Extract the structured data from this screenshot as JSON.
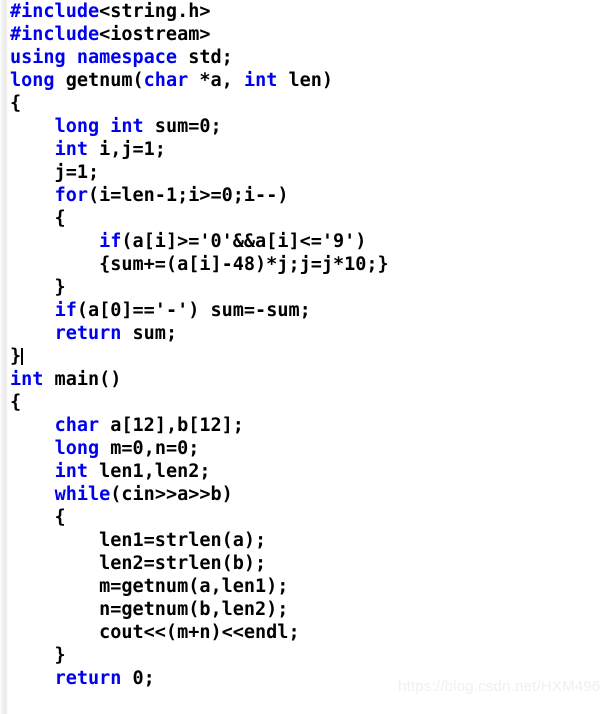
{
  "editor": {
    "background_color": "#ffffff",
    "text_color": "#000000",
    "keyword_color": "#0000f0",
    "font_size_px": 18.5,
    "line_height_px": 23,
    "language": "C++",
    "has_caret": true,
    "caret_line_index": 15
  },
  "code": {
    "lines": [
      {
        "index": 0,
        "tokens": [
          {
            "t": "#include",
            "c": "kw"
          },
          {
            "t": "<string.h>",
            "c": "pl"
          }
        ]
      },
      {
        "index": 1,
        "tokens": [
          {
            "t": "#include",
            "c": "kw"
          },
          {
            "t": "<iostream>",
            "c": "pl"
          }
        ]
      },
      {
        "index": 2,
        "tokens": [
          {
            "t": "using namespace",
            "c": "kw"
          },
          {
            "t": " std;",
            "c": "pl"
          }
        ]
      },
      {
        "index": 3,
        "tokens": [
          {
            "t": "long",
            "c": "kw"
          },
          {
            "t": " getnum(",
            "c": "pl"
          },
          {
            "t": "char",
            "c": "kw"
          },
          {
            "t": " *a, ",
            "c": "pl"
          },
          {
            "t": "int",
            "c": "kw"
          },
          {
            "t": " len)",
            "c": "pl"
          }
        ]
      },
      {
        "index": 4,
        "tokens": [
          {
            "t": "{",
            "c": "pl"
          }
        ]
      },
      {
        "index": 5,
        "tokens": [
          {
            "t": "    ",
            "c": "pl"
          },
          {
            "t": "long int",
            "c": "kw"
          },
          {
            "t": " sum=0;",
            "c": "pl"
          }
        ]
      },
      {
        "index": 6,
        "tokens": [
          {
            "t": "    ",
            "c": "pl"
          },
          {
            "t": "int",
            "c": "kw"
          },
          {
            "t": " i,j=1;",
            "c": "pl"
          }
        ]
      },
      {
        "index": 7,
        "tokens": [
          {
            "t": "    j=1;",
            "c": "pl"
          }
        ]
      },
      {
        "index": 8,
        "tokens": [
          {
            "t": "    ",
            "c": "pl"
          },
          {
            "t": "for",
            "c": "kw"
          },
          {
            "t": "(i=len-1;i>=0;i--)",
            "c": "pl"
          }
        ]
      },
      {
        "index": 9,
        "tokens": [
          {
            "t": "    {",
            "c": "pl"
          }
        ]
      },
      {
        "index": 10,
        "tokens": [
          {
            "t": "        ",
            "c": "pl"
          },
          {
            "t": "if",
            "c": "kw"
          },
          {
            "t": "(a[i]>='0'&&a[i]<='9')",
            "c": "pl"
          }
        ]
      },
      {
        "index": 11,
        "tokens": [
          {
            "t": "        {sum+=(a[i]-48)*j;j=j*10;}",
            "c": "pl"
          }
        ]
      },
      {
        "index": 12,
        "tokens": [
          {
            "t": "    }",
            "c": "pl"
          }
        ]
      },
      {
        "index": 13,
        "tokens": [
          {
            "t": "    ",
            "c": "pl"
          },
          {
            "t": "if",
            "c": "kw"
          },
          {
            "t": "(a[0]=='-') sum=-sum;",
            "c": "pl"
          }
        ]
      },
      {
        "index": 14,
        "tokens": [
          {
            "t": "    ",
            "c": "pl"
          },
          {
            "t": "return",
            "c": "kw"
          },
          {
            "t": " sum;",
            "c": "pl"
          }
        ]
      },
      {
        "index": 15,
        "tokens": [
          {
            "t": "}",
            "c": "pl"
          }
        ]
      },
      {
        "index": 16,
        "tokens": [
          {
            "t": "int",
            "c": "kw"
          },
          {
            "t": " main()",
            "c": "pl"
          }
        ]
      },
      {
        "index": 17,
        "tokens": [
          {
            "t": "{",
            "c": "pl"
          }
        ]
      },
      {
        "index": 18,
        "tokens": [
          {
            "t": "    ",
            "c": "pl"
          },
          {
            "t": "char",
            "c": "kw"
          },
          {
            "t": " a[12],b[12];",
            "c": "pl"
          }
        ]
      },
      {
        "index": 19,
        "tokens": [
          {
            "t": "    ",
            "c": "pl"
          },
          {
            "t": "long",
            "c": "kw"
          },
          {
            "t": " m=0,n=0;",
            "c": "pl"
          }
        ]
      },
      {
        "index": 20,
        "tokens": [
          {
            "t": "    ",
            "c": "pl"
          },
          {
            "t": "int",
            "c": "kw"
          },
          {
            "t": " len1,len2;",
            "c": "pl"
          }
        ]
      },
      {
        "index": 21,
        "tokens": [
          {
            "t": "    ",
            "c": "pl"
          },
          {
            "t": "while",
            "c": "kw"
          },
          {
            "t": "(cin>>a>>b)",
            "c": "pl"
          }
        ]
      },
      {
        "index": 22,
        "tokens": [
          {
            "t": "    {",
            "c": "pl"
          }
        ]
      },
      {
        "index": 23,
        "tokens": [
          {
            "t": "        len1=strlen(a);",
            "c": "pl"
          }
        ]
      },
      {
        "index": 24,
        "tokens": [
          {
            "t": "        len2=strlen(b);",
            "c": "pl"
          }
        ]
      },
      {
        "index": 25,
        "tokens": [
          {
            "t": "        m=getnum(a,len1);",
            "c": "pl"
          }
        ]
      },
      {
        "index": 26,
        "tokens": [
          {
            "t": "        n=getnum(b,len2);",
            "c": "pl"
          }
        ]
      },
      {
        "index": 27,
        "tokens": [
          {
            "t": "        cout<<(m+n)<<endl;",
            "c": "pl"
          }
        ]
      },
      {
        "index": 28,
        "tokens": [
          {
            "t": "    }",
            "c": "pl"
          }
        ]
      },
      {
        "index": 29,
        "tokens": [
          {
            "t": "    ",
            "c": "pl"
          },
          {
            "t": "return",
            "c": "kw"
          },
          {
            "t": " 0;",
            "c": "pl"
          }
        ]
      }
    ]
  },
  "watermark": {
    "text": "https://blog.csdn.net/HXM496",
    "color": "#f0f0f0"
  }
}
